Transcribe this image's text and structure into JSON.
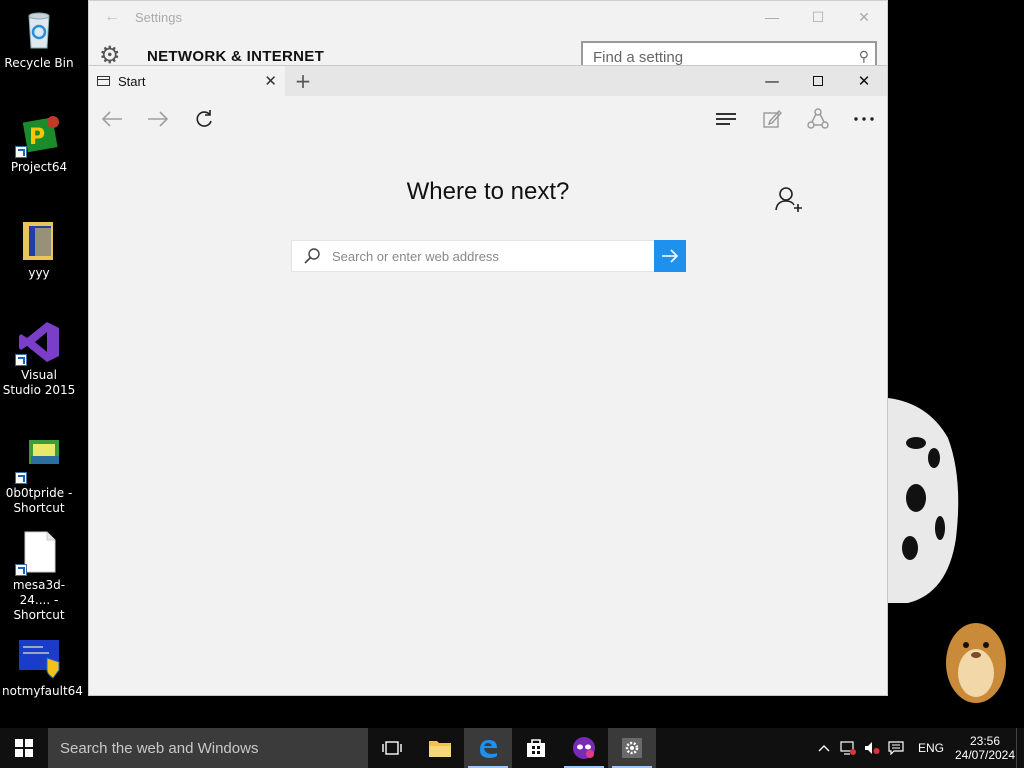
{
  "desktop": {
    "icons": [
      {
        "label": "Recycle Bin"
      },
      {
        "label": "Project64"
      },
      {
        "label": "yyy"
      },
      {
        "label": "Visual Studio 2015"
      },
      {
        "label": "0b0tpride - Shortcut"
      },
      {
        "label": "mesa3d-24.... - Shortcut"
      },
      {
        "label": "notmyfault64"
      }
    ]
  },
  "settings_window": {
    "title": "Settings",
    "heading": "NETWORK & INTERNET",
    "search_placeholder": "Find a setting"
  },
  "edge_window": {
    "tab_title": "Start",
    "new_tab_label": "+",
    "heading": "Where to next?",
    "address_placeholder": "Search or enter web address",
    "address_value": ""
  },
  "taskbar": {
    "search_text": "Search the web and Windows",
    "language": "ENG",
    "time": "23:56",
    "date": "24/07/2024"
  },
  "colors": {
    "accent": "#1e90ee",
    "taskbar": "#101010",
    "edge_bg": "#f2f2f2"
  }
}
